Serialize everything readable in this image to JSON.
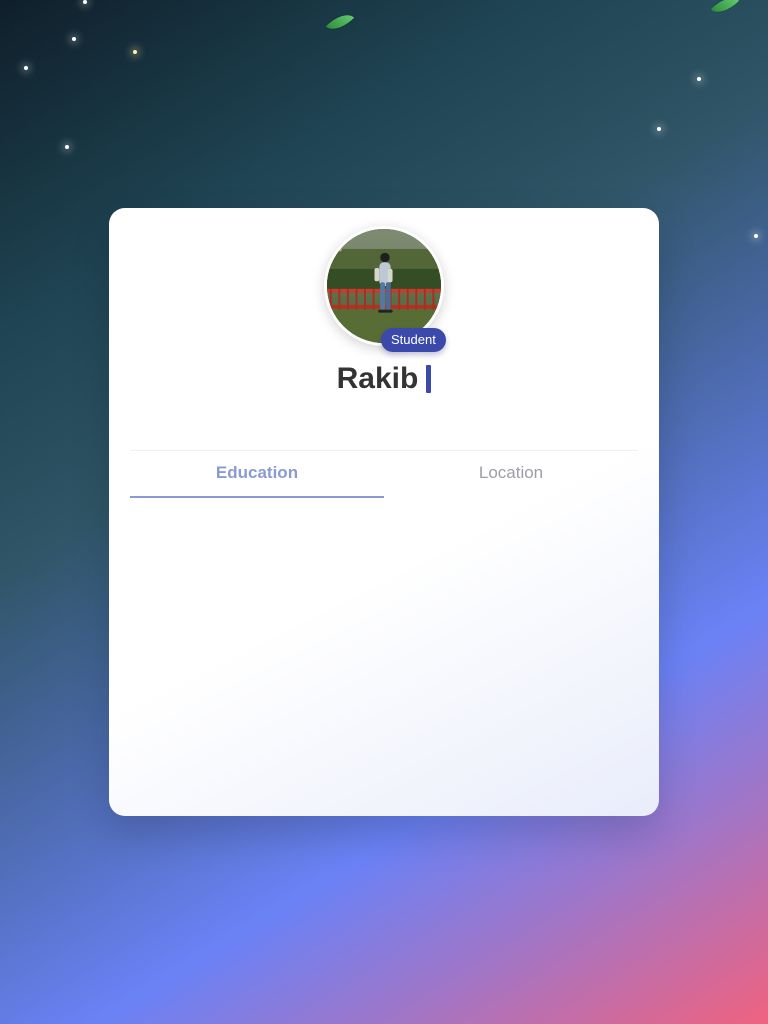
{
  "profile": {
    "name": "Rakib",
    "badge": "Student"
  },
  "tabs": [
    {
      "label": "Education",
      "active": true
    },
    {
      "label": "Location",
      "active": false
    }
  ],
  "theme": {
    "badge_color": "#3b49aa",
    "active_tab_color": "#8c9ad4",
    "inactive_tab_color": "#9d9da8"
  }
}
